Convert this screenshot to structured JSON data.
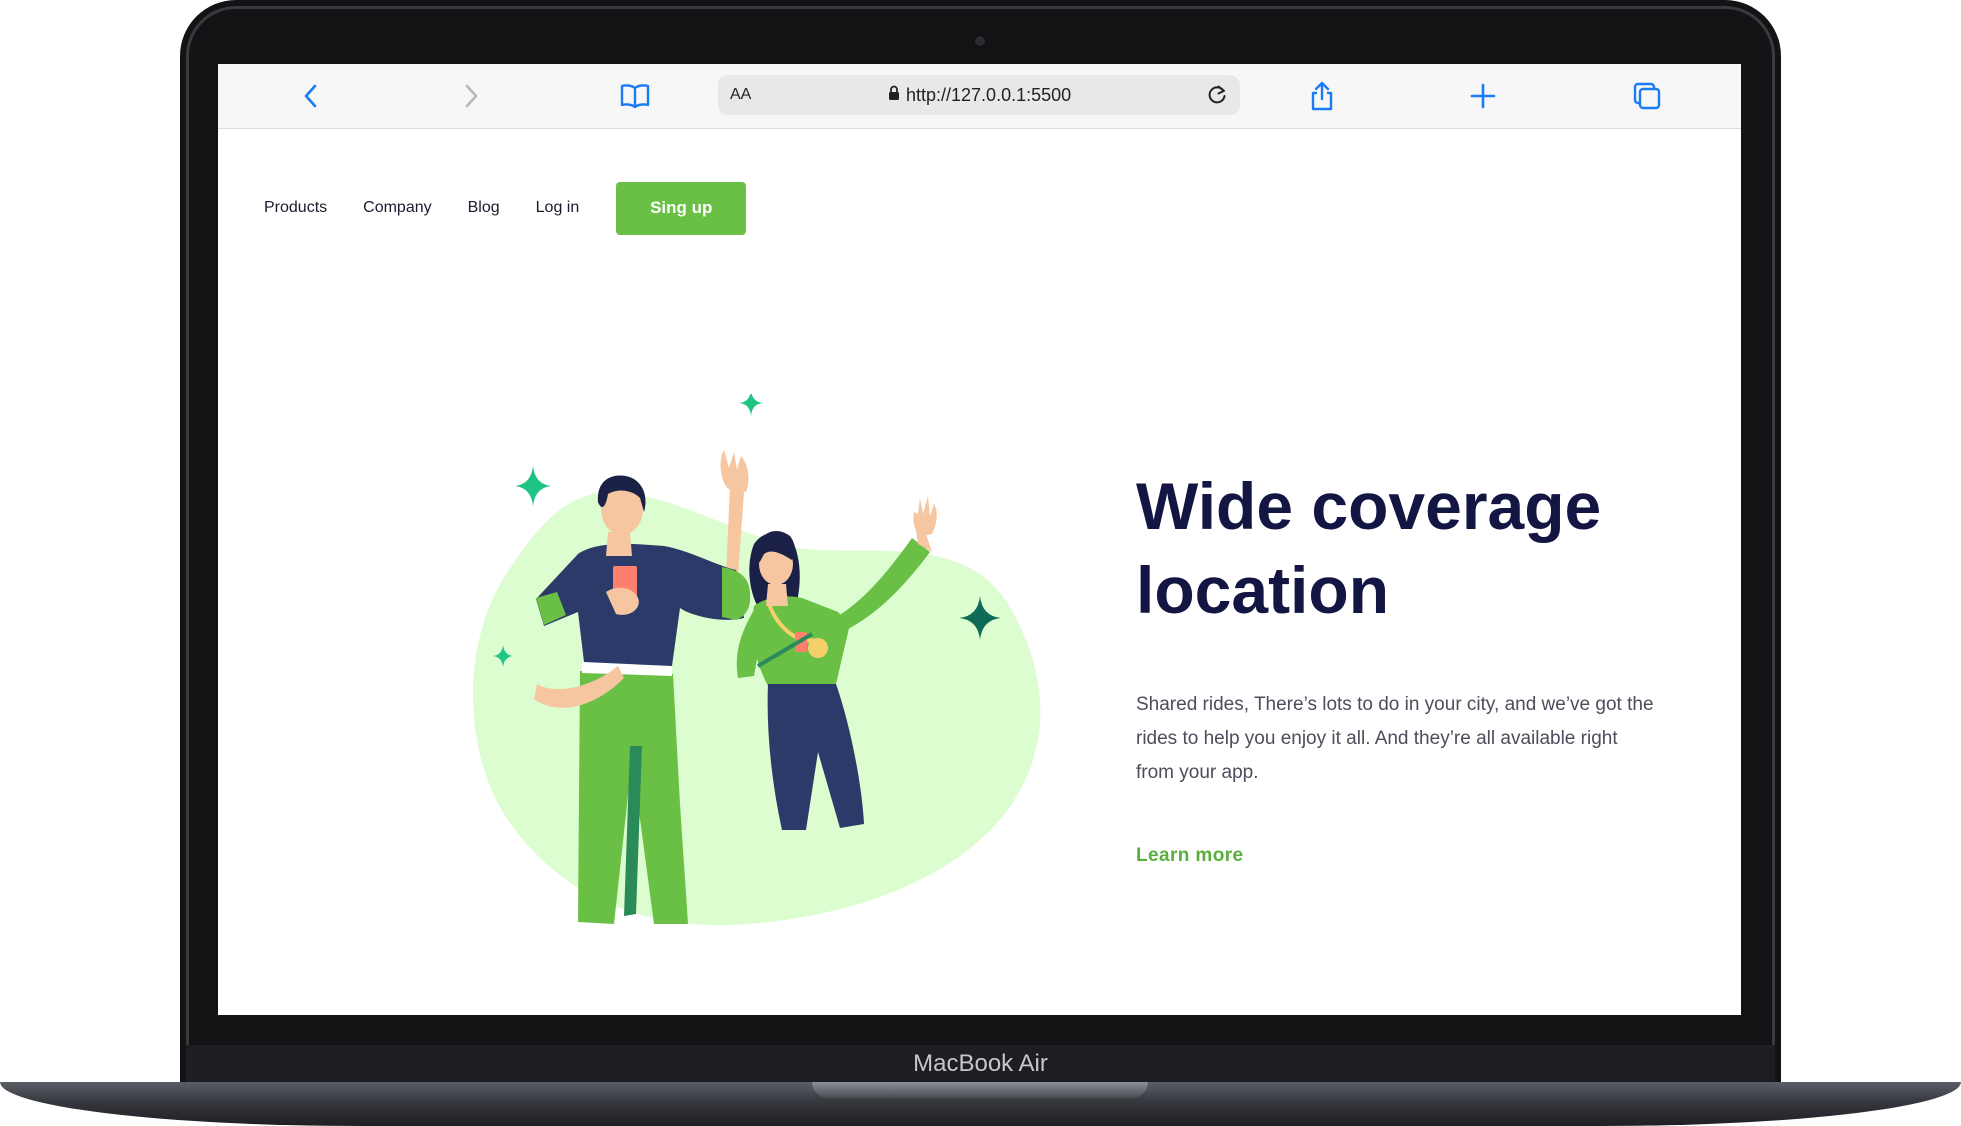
{
  "device": {
    "model_label": "MacBook Air"
  },
  "browser": {
    "text_size_label": "AA",
    "url": "http://127.0.0.1:5500",
    "icons": [
      "back-arrow-icon",
      "forward-arrow-icon",
      "bookmarks-book-icon",
      "lock-icon",
      "reload-icon",
      "share-icon",
      "new-tab-plus-icon",
      "tabs-overview-icon"
    ],
    "accent_color": "#1a7cf5"
  },
  "nav": {
    "links": [
      "Products",
      "Company",
      "Blog",
      "Log in"
    ],
    "signup_label": "Sing up"
  },
  "hero": {
    "title_line1": "Wide coverage",
    "title_line2": "location",
    "description": "Shared rides, There’s lots to do in your city, and we’ve got the rides to help you enjoy it all. And they’re all available right from your app.",
    "cta_label": "Learn more"
  },
  "colors": {
    "brand_green": "#6abf45",
    "heading_navy": "#131642",
    "blob_green": "#dcfdd0",
    "sparkle_teal": "#1fc485"
  }
}
